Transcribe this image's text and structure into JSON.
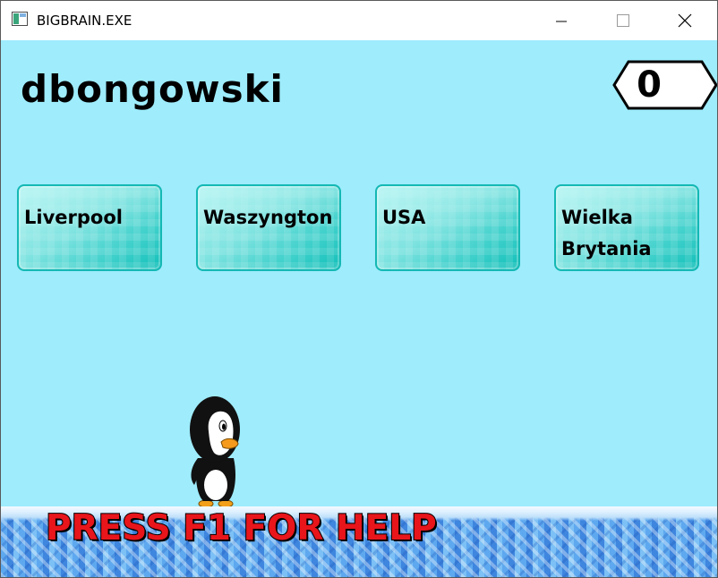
{
  "window": {
    "title": "BIGBRAIN.EXE",
    "icons": [
      "app-icon",
      "minimize-icon",
      "maximize-icon",
      "close-icon"
    ]
  },
  "game": {
    "player_name": "dbongowski",
    "score": "0",
    "answers": [
      {
        "label": "Liverpool"
      },
      {
        "label": "Waszyngton"
      },
      {
        "label": "USA"
      },
      {
        "label": "Wielka\nBrytania"
      }
    ],
    "help_text": "PRESS F1 FOR HELP",
    "character": "penguin",
    "colors": {
      "background": "#9eecfc",
      "answer_box": "#3fd0cb",
      "help_text": "#e8151b",
      "ice": "#4c97e6"
    }
  }
}
